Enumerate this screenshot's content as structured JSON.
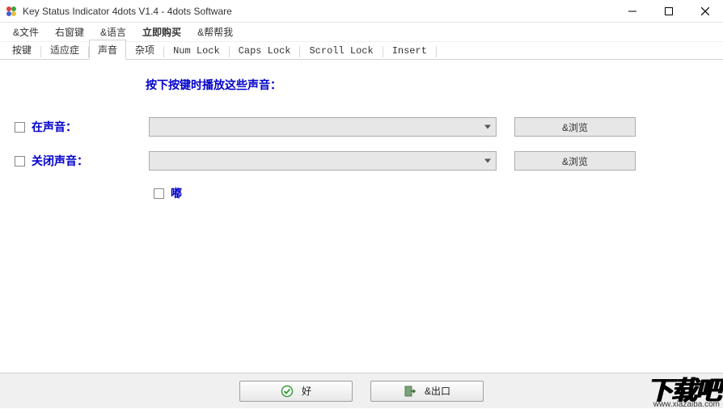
{
  "window": {
    "title": "Key Status Indicator 4dots V1.4 - 4dots Software"
  },
  "menu": {
    "file": "&文件",
    "right_key": "右窗键",
    "language": "&语言",
    "buy_now": "立即购买",
    "help": "&帮帮我"
  },
  "tabs": {
    "keys": "按键",
    "adapt": "适应症",
    "sound": "声音",
    "misc": "杂项",
    "numlock": "Num Lock",
    "capslock": "Caps Lock",
    "scrolllock": "Scroll Lock",
    "insert": "Insert"
  },
  "content": {
    "heading": "按下按键时播放这些声音：",
    "on_sound_label": "在声音：",
    "off_sound_label": "关闭声音：",
    "browse_label": "&浏览",
    "beep_label": "嘟",
    "on_sound_value": "",
    "off_sound_value": ""
  },
  "buttons": {
    "ok": "好",
    "exit": "&出口"
  },
  "watermark": {
    "big": "下载吧",
    "url": "www.xiazaiba.com"
  }
}
